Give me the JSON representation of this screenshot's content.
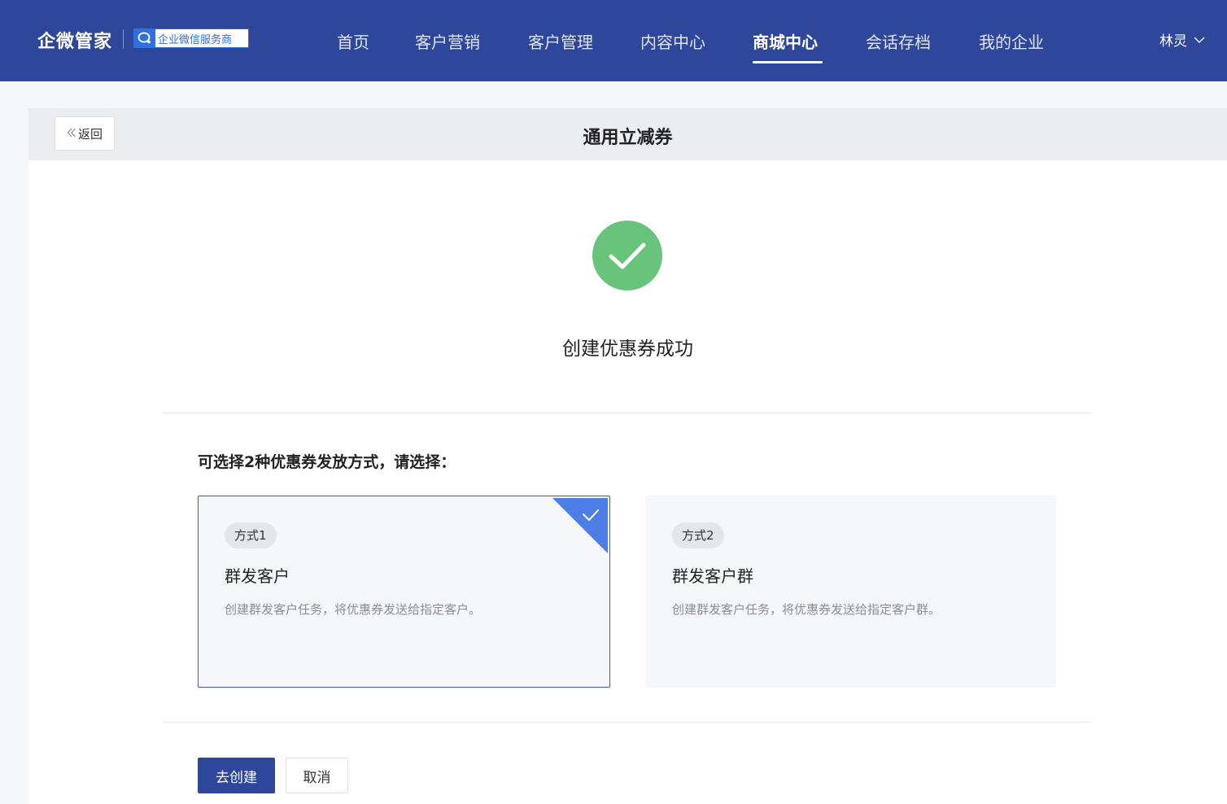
{
  "app": {
    "logo": "企微管家",
    "partner_badge": "企业微信服务商"
  },
  "nav": {
    "items": [
      {
        "label": "首页"
      },
      {
        "label": "客户营销"
      },
      {
        "label": "客户管理"
      },
      {
        "label": "内容中心"
      },
      {
        "label": "商城中心",
        "active": true
      },
      {
        "label": "会话存档"
      },
      {
        "label": "我的企业"
      }
    ],
    "user": "林灵"
  },
  "header": {
    "back_label": "返回",
    "title": "通用立减券"
  },
  "result": {
    "message": "创建优惠券成功",
    "icon": "check-circle-icon",
    "color": "#67c47a"
  },
  "distribution": {
    "prompt": "可选择2种优惠券发放方式，请选择：",
    "options": [
      {
        "tag": "方式1",
        "title": "群发客户",
        "desc": "创建群发客户任务，将优惠券发送给指定客户。",
        "selected": true
      },
      {
        "tag": "方式2",
        "title": "群发客户群",
        "desc": "创建群发客户任务，将优惠券发送给指定客户群。",
        "selected": false
      }
    ]
  },
  "actions": {
    "create_label": "去创建",
    "cancel_label": "取消"
  },
  "colors": {
    "nav_bg": "#2f479b",
    "primary": "#2f479b",
    "selected_corner": "#4d7ee8",
    "success": "#67c47a"
  }
}
